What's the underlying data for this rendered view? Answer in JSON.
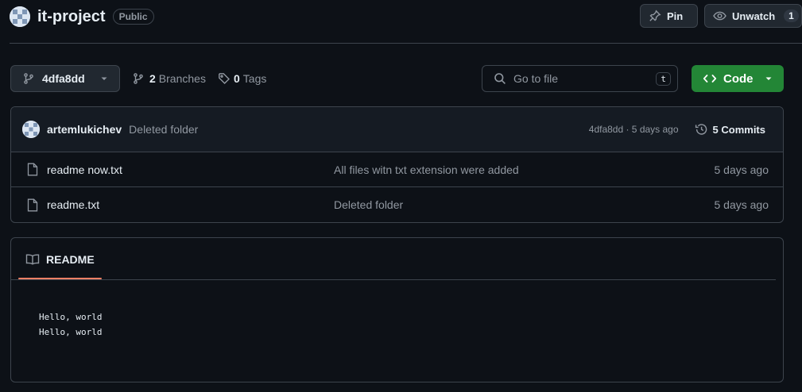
{
  "repo": {
    "name": "it-project",
    "visibility": "Public"
  },
  "header_actions": {
    "pin_label": "Pin",
    "unwatch_label": "Unwatch",
    "watch_count": "1"
  },
  "toolbar": {
    "branch": "4dfa8dd",
    "branches_count": "2",
    "branches_label": "Branches",
    "tags_count": "0",
    "tags_label": "Tags",
    "search_placeholder": "Go to file",
    "search_shortcut": "t",
    "code_label": "Code"
  },
  "latest_commit": {
    "author": "artemlukichev",
    "message": "Deleted folder",
    "meta": "4dfa8dd · 5 days ago",
    "commits_label": "5 Commits"
  },
  "files": [
    {
      "name": "readme now.txt",
      "message": "All files witn txt extension were added",
      "date": "5 days ago"
    },
    {
      "name": "readme.txt",
      "message": "Deleted folder",
      "date": "5 days ago"
    }
  ],
  "readme": {
    "tab_label": "README",
    "lines": [
      "Hello, world",
      "Hello, world"
    ]
  },
  "colors": {
    "background": "#0d1117",
    "border": "#3d444d",
    "code_button": "#238636",
    "readme_underline": "#f78166"
  }
}
